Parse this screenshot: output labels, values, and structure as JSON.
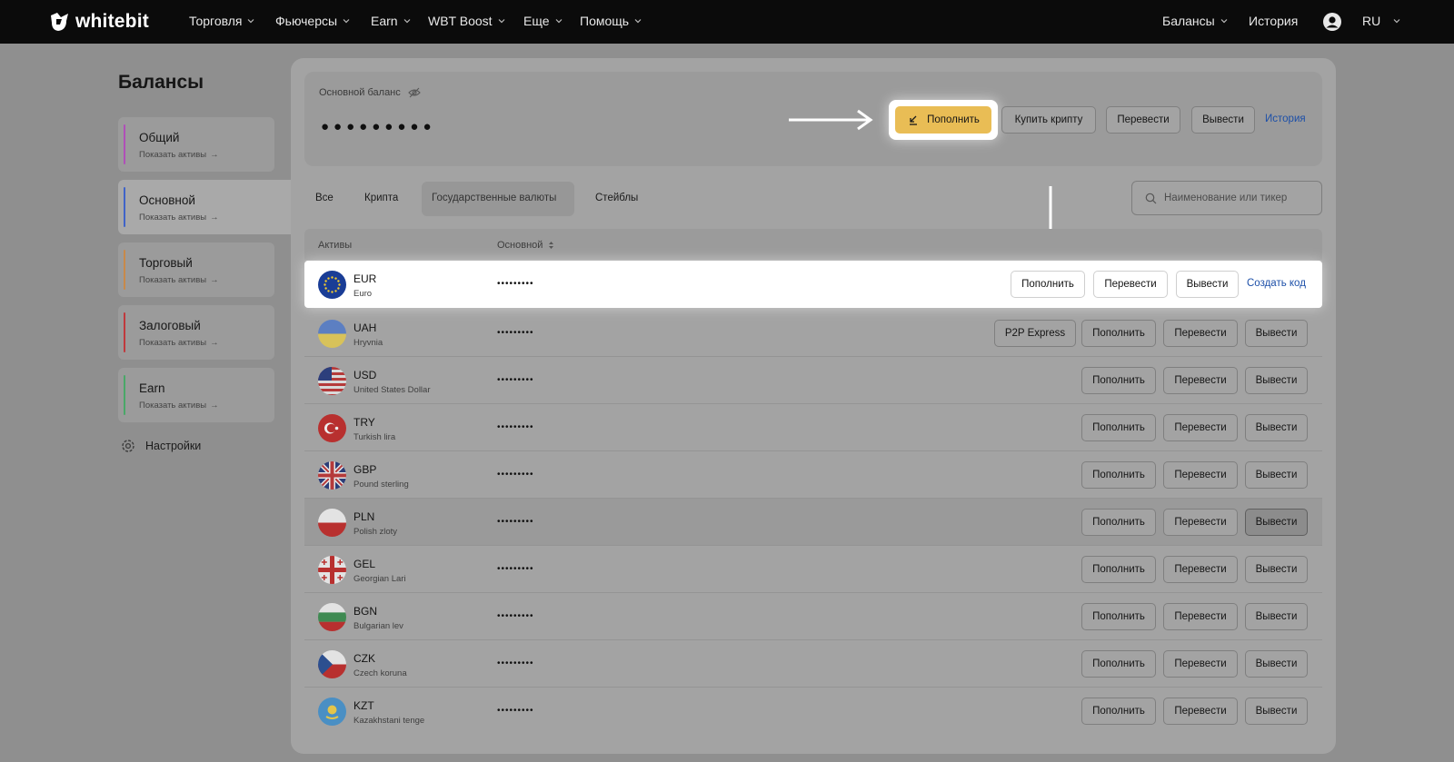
{
  "brand": {
    "logo_text": "whitebit"
  },
  "nav": {
    "items": [
      "Торговля",
      "Фьючерсы",
      "Earn",
      "WBT Boost",
      "Еще",
      "Помощь"
    ],
    "right": {
      "balances": "Балансы",
      "history": "История",
      "language": "RU"
    }
  },
  "sidebar": {
    "title": "Балансы",
    "items": [
      {
        "name": "Общий",
        "sub": "Показать активы",
        "color": "#b04fb8"
      },
      {
        "name": "Основной",
        "sub": "Показать активы",
        "color": "#3f63c9"
      },
      {
        "name": "Торговый",
        "sub": "Показать активы",
        "color": "#c8894a"
      },
      {
        "name": "Залоговый",
        "sub": "Показать активы",
        "color": "#c0393d"
      },
      {
        "name": "Earn",
        "sub": "Показать активы",
        "color": "#4aa768"
      }
    ],
    "settings": "Настройки"
  },
  "balance": {
    "label": "Основной баланс",
    "value": "●●●●●●●●●",
    "actions": {
      "deposit": "Пополнить",
      "buy": "Купить крипту",
      "transfer": "Перевести",
      "withdraw": "Вывести",
      "history": "История"
    }
  },
  "tabs": [
    "Все",
    "Крипта",
    "Государственные валюты",
    "Стейблы"
  ],
  "active_tab": "Государственные валюты",
  "search": {
    "placeholder": "Наименование или тикер"
  },
  "table": {
    "headers": {
      "asset": "Активы",
      "main": "Основной"
    },
    "mask": "•••••••••",
    "actions": {
      "p2p": "P2P Express",
      "deposit": "Пополнить",
      "transfer": "Перевести",
      "withdraw": "Вывести",
      "create_code": "Создать код"
    },
    "rows": [
      {
        "ticker": "EUR",
        "name": "Euro"
      },
      {
        "ticker": "UAH",
        "name": "Hryvnia"
      },
      {
        "ticker": "USD",
        "name": "United States Dollar"
      },
      {
        "ticker": "TRY",
        "name": "Turkish lira"
      },
      {
        "ticker": "GBP",
        "name": "Pound sterling"
      },
      {
        "ticker": "PLN",
        "name": "Polish zloty"
      },
      {
        "ticker": "GEL",
        "name": "Georgian Lari"
      },
      {
        "ticker": "BGN",
        "name": "Bulgarian lev"
      },
      {
        "ticker": "CZK",
        "name": "Czech koruna"
      },
      {
        "ticker": "KZT",
        "name": "Kazakhstani tenge"
      }
    ]
  },
  "colors": {
    "accent": "#e9bd55",
    "link": "#1c4fa8",
    "topbar": "#0b0b0b"
  }
}
